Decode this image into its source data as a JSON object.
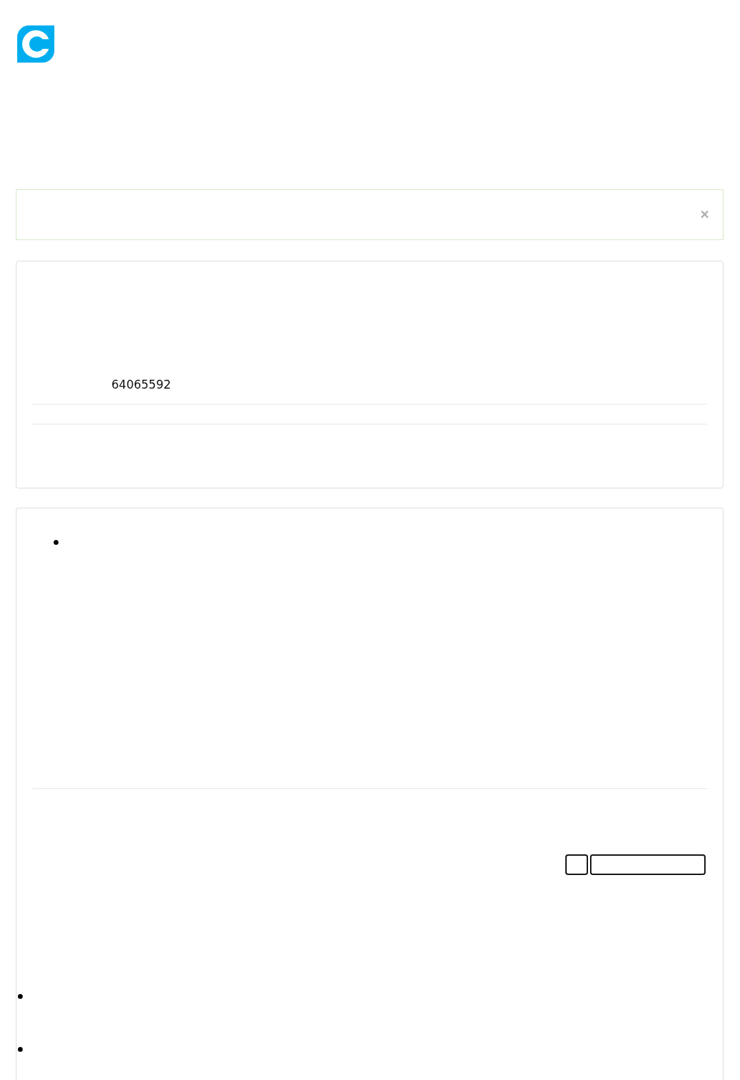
{
  "alert": {
    "close": "×"
  },
  "details": {
    "number": "64065592"
  }
}
